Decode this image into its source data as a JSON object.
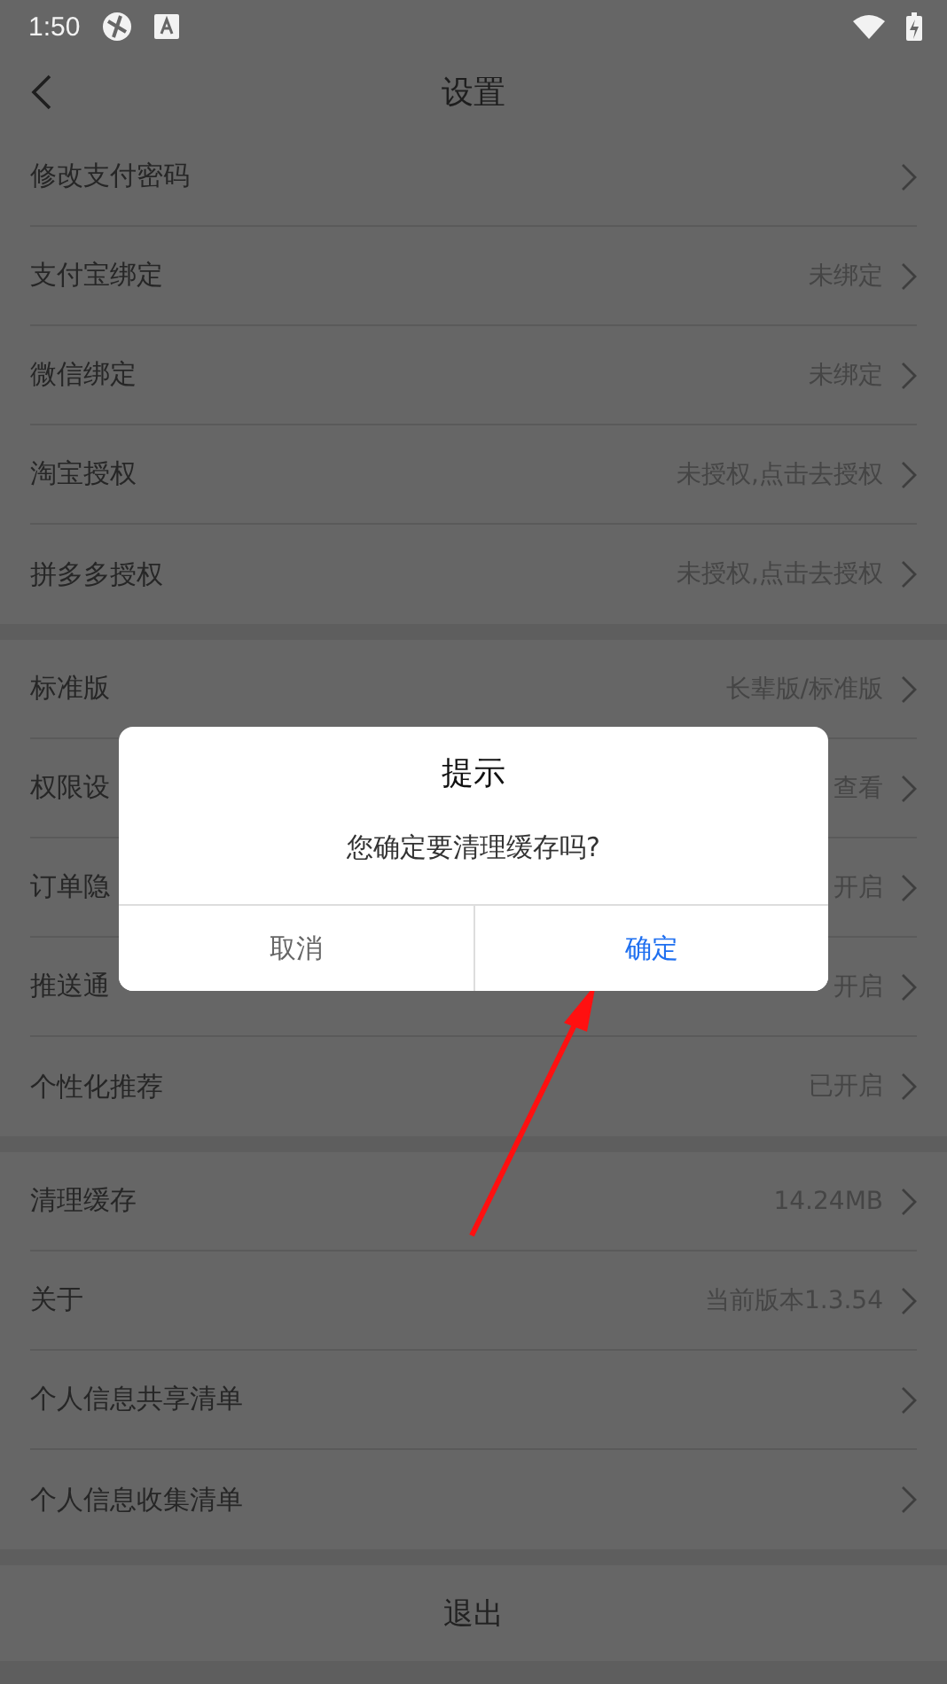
{
  "status_bar": {
    "time": "1:50"
  },
  "header": {
    "title": "设置"
  },
  "sections": [
    {
      "rows": [
        {
          "label": "修改支付密码"
        },
        {
          "label": "支付宝绑定",
          "value": "未绑定"
        },
        {
          "label": "微信绑定",
          "value": "未绑定"
        },
        {
          "label": "淘宝授权",
          "value": "未授权,点击去授权"
        },
        {
          "label": "拼多多授权",
          "value": "未授权,点击去授权"
        }
      ]
    },
    {
      "rows": [
        {
          "label": "标准版",
          "value": "长辈版/标准版"
        },
        {
          "label": "权限设",
          "value": "查看"
        },
        {
          "label": "订单隐",
          "value": "开启"
        },
        {
          "label": "推送通",
          "value": "开启"
        },
        {
          "label": "个性化推荐",
          "value": "已开启"
        }
      ]
    },
    {
      "rows": [
        {
          "label": "清理缓存",
          "value": "14.24MB"
        },
        {
          "label": "关于",
          "value": "当前版本1.3.54"
        },
        {
          "label": "个人信息共享清单"
        },
        {
          "label": "个人信息收集清单"
        }
      ]
    }
  ],
  "logout": {
    "label": "退出"
  },
  "dialog": {
    "title": "提示",
    "message": "您确定要清理缓存吗?",
    "buttons": [
      {
        "label": "取消",
        "primary": false
      },
      {
        "label": "确定",
        "primary": true
      }
    ]
  }
}
